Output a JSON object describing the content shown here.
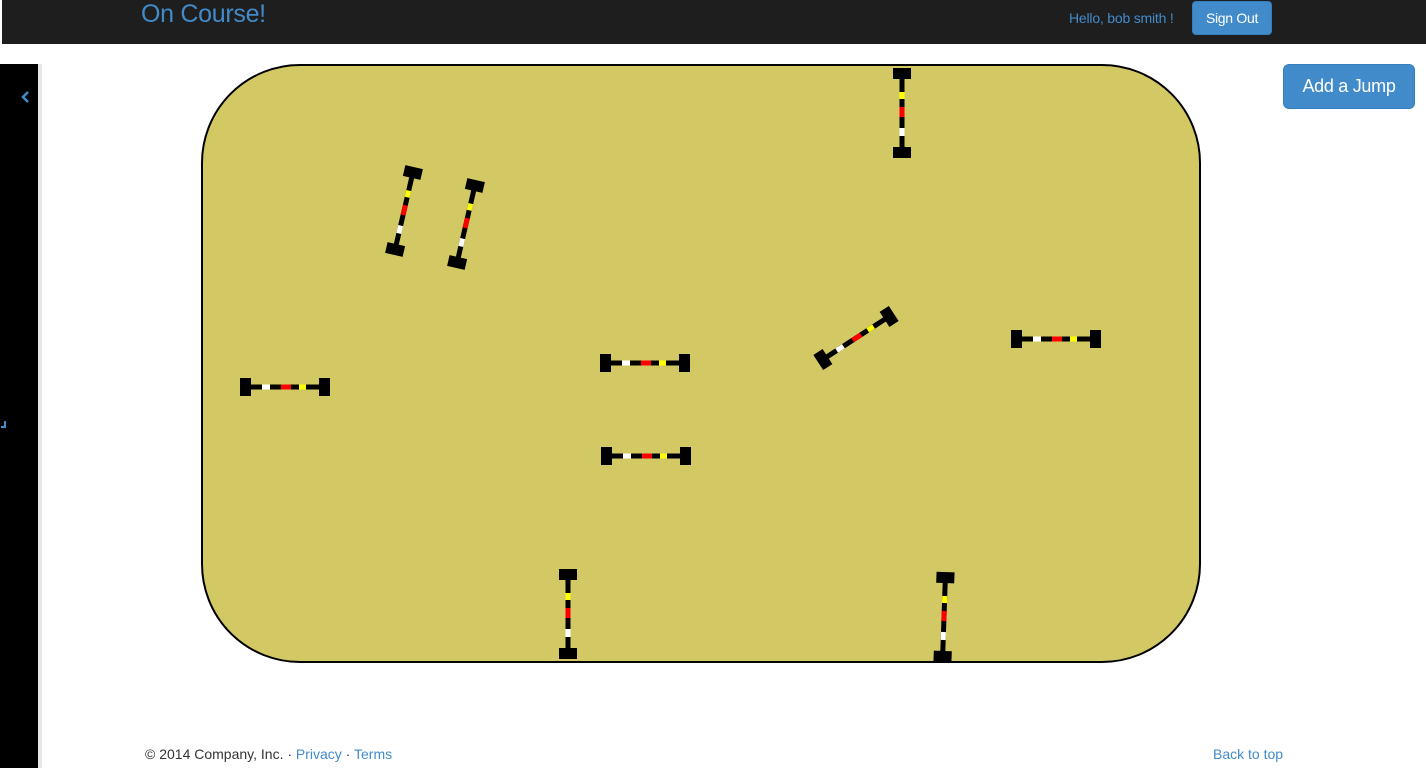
{
  "header": {
    "brand": "On Course!",
    "greeting": "Hello, bob smith !",
    "sign_out_label": "Sign Out"
  },
  "sidebar": {
    "toggle_icon": "chevron-left-icon"
  },
  "toolbar": {
    "add_jump_label": "Add a Jump"
  },
  "arena": {
    "fill_color": "#d3c964",
    "border_color": "#000000",
    "jump_count": 10,
    "pole_colors": [
      "#000000",
      "#ffffff",
      "#ff0000",
      "#ffff00"
    ]
  },
  "footer": {
    "copyright": "© 2014 Company, Inc. · ",
    "privacy": "Privacy",
    "separator": " · ",
    "terms": "Terms",
    "back_to_top": "Back to top"
  },
  "colors": {
    "accent": "#428bca",
    "navbar": "#1e1e1e"
  }
}
